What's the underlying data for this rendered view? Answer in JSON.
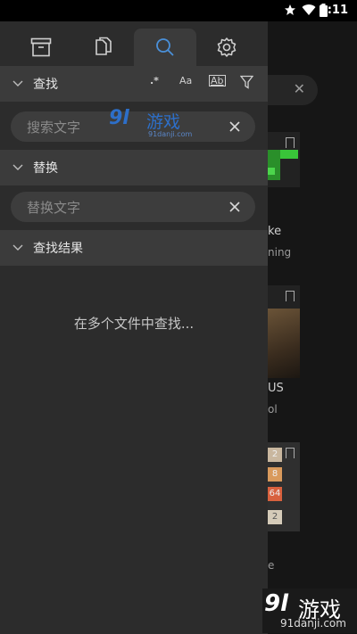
{
  "status_bar": {
    "time": "2:11"
  },
  "drawer": {
    "tabs": [
      {
        "name": "archive"
      },
      {
        "name": "files"
      },
      {
        "name": "search",
        "active": true
      },
      {
        "name": "settings"
      }
    ],
    "find": {
      "title": "查找",
      "options": {
        "regex": ".*",
        "match_case": "Aa",
        "whole_word": "Ab"
      },
      "input_placeholder": "搜索文字"
    },
    "replace": {
      "title": "替换",
      "input_placeholder": "替换文字"
    },
    "results": {
      "title": "查找结果",
      "empty_message": "在多个文件中查找..."
    }
  },
  "background": {
    "card1_title": "ke",
    "card1_sub": "ning",
    "card2_title": "US",
    "card2_sub": "ol",
    "card3_tiles": [
      "2",
      "8",
      "64",
      "2"
    ],
    "card3_sub": "e"
  },
  "watermark": {
    "logo_num": "9l",
    "logo_text": "游戏",
    "small_url": "91danji.com",
    "corner_url": "91danji.com"
  }
}
